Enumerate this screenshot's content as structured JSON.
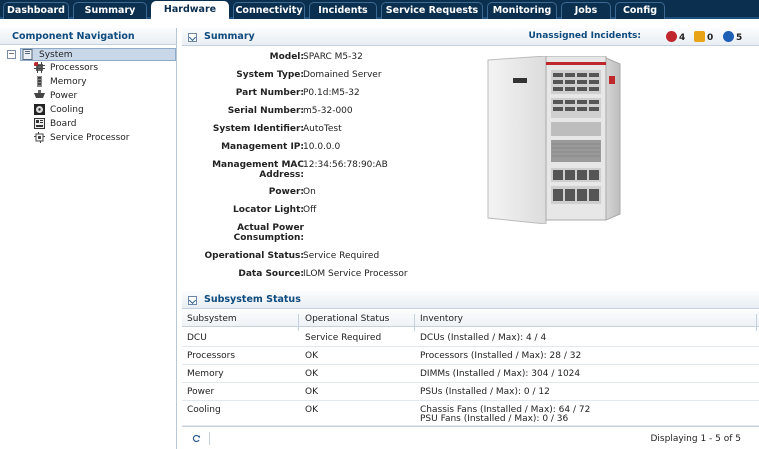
{
  "tabs": [
    {
      "label": "Dashboard"
    },
    {
      "label": "Summary"
    },
    {
      "label": "Hardware"
    },
    {
      "label": "Connectivity"
    },
    {
      "label": "Incidents"
    },
    {
      "label": "Service Requests"
    },
    {
      "label": "Monitoring"
    },
    {
      "label": "Jobs"
    },
    {
      "label": "Config"
    }
  ],
  "active_tab": "Hardware",
  "nav": {
    "title": "Component Navigation",
    "root": "System",
    "items": [
      {
        "label": "Processors",
        "icon": "processor-icon"
      },
      {
        "label": "Memory",
        "icon": "memory-icon"
      },
      {
        "label": "Power",
        "icon": "power-icon"
      },
      {
        "label": "Cooling",
        "icon": "cooling-icon"
      },
      {
        "label": "Board",
        "icon": "board-icon"
      },
      {
        "label": "Service Processor",
        "icon": "service-processor-icon"
      }
    ]
  },
  "summary": {
    "title": "Summary",
    "unassigned_label": "Unassigned Incidents:",
    "incidents": {
      "critical": "4",
      "warning": "0",
      "info": "5"
    },
    "fields": [
      {
        "key": "Model:",
        "value": "SPARC M5-32"
      },
      {
        "key": "System Type:",
        "value": "Domained Server"
      },
      {
        "key": "Part Number:",
        "value": "P0.1d:M5-32"
      },
      {
        "key": "Serial Number:",
        "value": "m5-32-000"
      },
      {
        "key": "System Identifier:",
        "value": "AutoTest"
      },
      {
        "key": "Management IP:",
        "value": "10.0.0.0"
      },
      {
        "key": "Management MAC",
        "key2": "Address:",
        "value": "12:34:56:78:90:AB"
      },
      {
        "key": "Power:",
        "value": "On"
      },
      {
        "key": "Locator Light:",
        "value": "Off"
      },
      {
        "key": "Actual Power",
        "key2": "Consumption:",
        "value": ""
      },
      {
        "key": "Operational Status:",
        "value": "Service Required"
      },
      {
        "key": "Data Source:",
        "value": "ILOM Service Processor"
      }
    ]
  },
  "subsystem": {
    "title": "Subsystem Status",
    "columns": [
      "Subsystem",
      "Operational Status",
      "Inventory"
    ],
    "rows": [
      {
        "subsystem": "DCU",
        "status": "Service Required",
        "inventory": "DCUs (Installed / Max): 4 / 4",
        "inventory2": ""
      },
      {
        "subsystem": "Processors",
        "status": "OK",
        "inventory": "Processors (Installed / Max): 28 / 32",
        "inventory2": ""
      },
      {
        "subsystem": "Memory",
        "status": "OK",
        "inventory": "DIMMs (Installed / Max): 304 / 1024",
        "inventory2": ""
      },
      {
        "subsystem": "Power",
        "status": "OK",
        "inventory": "PSUs (Installed / Max): 0 / 12",
        "inventory2": ""
      },
      {
        "subsystem": "Cooling",
        "status": "OK",
        "inventory": "Chassis Fans (Installed / Max): 64 / 72",
        "inventory2": "PSU Fans (Installed / Max): 0 / 36"
      }
    ],
    "footer": "Displaying 1 - 5 of 5"
  },
  "colors": {
    "tabbar": "#0b2f4f",
    "accent": "#0d4a7e",
    "critical": "#c0272d",
    "warning": "#e8a317",
    "info": "#1e5fb4"
  }
}
